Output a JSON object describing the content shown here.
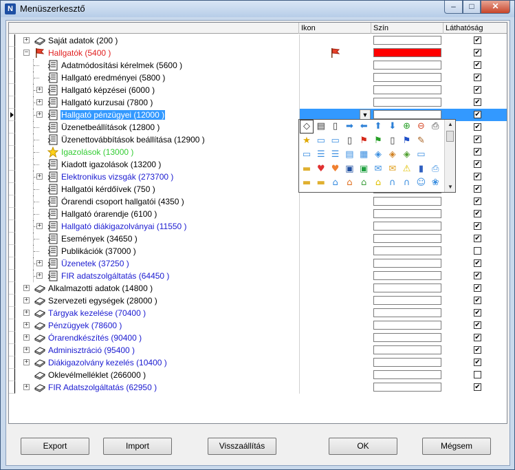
{
  "window": {
    "title": "Menüszerkesztő",
    "app_icon": "N",
    "minimize": "–",
    "maximize": "□",
    "close": "✕"
  },
  "columns": {
    "c1": "",
    "ikon": "Ikon",
    "szin": "Szín",
    "lathatosag": "Láthatóság"
  },
  "rows": [
    {
      "label": "Saját adatok (200 )",
      "level": 0,
      "expand": "+",
      "icon": "book-icon",
      "color": "#000000",
      "swatch": "",
      "checked": true
    },
    {
      "label": "Hallgatók (5400 )",
      "level": 0,
      "expand": "−",
      "icon": "flag-icon",
      "color": "#e02020",
      "swatch": "#ff0000",
      "ikon": "flag",
      "checked": true
    },
    {
      "label": "Adatmódosítási kérelmek (5600 )",
      "level": 1,
      "expand": "",
      "icon": "doc-icon",
      "color": "#000000",
      "swatch": "",
      "checked": true
    },
    {
      "label": "Hallgató eredményei (5800 )",
      "level": 1,
      "expand": "",
      "icon": "doc-icon",
      "color": "#000000",
      "swatch": "",
      "checked": true
    },
    {
      "label": "Hallgató képzései (6000 )",
      "level": 1,
      "expand": "+",
      "icon": "doc-icon",
      "color": "#000000",
      "swatch": "",
      "checked": true
    },
    {
      "label": "Hallgató kurzusai (7800 )",
      "level": 1,
      "expand": "+",
      "icon": "doc-icon",
      "color": "#000000",
      "swatch": "",
      "checked": true
    },
    {
      "label": "Hallgató pénzügyei (12000 )",
      "level": 1,
      "expand": "+",
      "icon": "doc-icon",
      "color": "#1a1ad0",
      "swatch": "",
      "checked": true,
      "selected": true
    },
    {
      "label": "Üzenetbeállítások (12800 )",
      "level": 1,
      "expand": "",
      "icon": "doc-icon",
      "color": "#000000",
      "swatch": "",
      "checked": true
    },
    {
      "label": "Üzenettovábbítások beállítása (12900 )",
      "level": 1,
      "expand": "",
      "icon": "doc-icon",
      "color": "#000000",
      "swatch": "",
      "checked": true
    },
    {
      "label": "Igazolások (13000 )",
      "level": 1,
      "expand": "",
      "icon": "star-icon",
      "color": "#33cc33",
      "swatch": "",
      "checked": true
    },
    {
      "label": "Kiadott igazolások (13200 )",
      "level": 1,
      "expand": "",
      "icon": "doc-icon",
      "color": "#000000",
      "swatch": "",
      "checked": true
    },
    {
      "label": "Elektronikus vizsgák (273700 )",
      "level": 1,
      "expand": "+",
      "icon": "doc-icon",
      "color": "#1a1ad0",
      "swatch": "",
      "checked": true
    },
    {
      "label": "Hallgatói kérdőívek (750 )",
      "level": 1,
      "expand": "",
      "icon": "doc-icon",
      "color": "#000000",
      "swatch": "",
      "checked": true
    },
    {
      "label": "Órarendi csoport hallgatói (4350 )",
      "level": 1,
      "expand": "",
      "icon": "doc-icon",
      "color": "#000000",
      "swatch": "",
      "checked": true
    },
    {
      "label": "Hallgató órarendje (6100 )",
      "level": 1,
      "expand": "",
      "icon": "doc-icon",
      "color": "#000000",
      "swatch": "",
      "checked": true
    },
    {
      "label": "Hallgató diákigazolványai (11550 )",
      "level": 1,
      "expand": "+",
      "icon": "doc-icon",
      "color": "#1a1ad0",
      "swatch": "",
      "checked": true
    },
    {
      "label": "Események (34650 )",
      "level": 1,
      "expand": "",
      "icon": "doc-icon",
      "color": "#000000",
      "swatch": "",
      "checked": true
    },
    {
      "label": "Publikációk (37000 )",
      "level": 1,
      "expand": "",
      "icon": "doc-icon",
      "color": "#000000",
      "swatch": "",
      "checked": false
    },
    {
      "label": "Üzenetek (37250 )",
      "level": 1,
      "expand": "+",
      "icon": "doc-icon",
      "color": "#1a1ad0",
      "swatch": "",
      "checked": true
    },
    {
      "label": "FIR adatszolgáltatás (64450 )",
      "level": 1,
      "expand": "+",
      "icon": "doc-icon",
      "color": "#1a1ad0",
      "swatch": "",
      "checked": true
    },
    {
      "label": "Alkalmazotti adatok (14800 )",
      "level": 0,
      "expand": "+",
      "icon": "book-icon",
      "color": "#000000",
      "swatch": "",
      "checked": true
    },
    {
      "label": "Szervezeti egységek (28000 )",
      "level": 0,
      "expand": "+",
      "icon": "book-icon",
      "color": "#000000",
      "swatch": "",
      "checked": true
    },
    {
      "label": "Tárgyak kezelése (70400 )",
      "level": 0,
      "expand": "+",
      "icon": "book-icon",
      "color": "#1a1ad0",
      "swatch": "",
      "checked": true
    },
    {
      "label": "Pénzügyek (78600 )",
      "level": 0,
      "expand": "+",
      "icon": "book-icon",
      "color": "#1a1ad0",
      "swatch": "",
      "checked": true
    },
    {
      "label": "Órarendkészítés (90400 )",
      "level": 0,
      "expand": "+",
      "icon": "book-icon",
      "color": "#1a1ad0",
      "swatch": "",
      "checked": true
    },
    {
      "label": "Adminisztráció (95400 )",
      "level": 0,
      "expand": "+",
      "icon": "book-icon",
      "color": "#1a1ad0",
      "swatch": "",
      "checked": true
    },
    {
      "label": "Diákigazolvány kezelés (10400 )",
      "level": 0,
      "expand": "+",
      "icon": "book-icon",
      "color": "#1a1ad0",
      "swatch": "",
      "checked": true
    },
    {
      "label": "Oklevélmelléklet (266000 )",
      "level": 0,
      "expand": "",
      "icon": "book-icon",
      "color": "#000000",
      "swatch": "",
      "checked": false
    },
    {
      "label": "FIR Adatszolgáltatás (62950 )",
      "level": 0,
      "expand": "+",
      "icon": "book-icon",
      "color": "#1a1ad0",
      "swatch": "",
      "checked": true
    }
  ],
  "picker_icons": [
    [
      "book",
      "doc",
      "page",
      "arrow-right",
      "arrow-left",
      "arrow-up",
      "arrow-down",
      "plus",
      "minus",
      "printer"
    ],
    [
      "star",
      "chat",
      "chat2",
      "page2",
      "flag-red",
      "flag-green",
      "page3",
      "flag-blue",
      "pencil"
    ],
    [
      "window",
      "list",
      "list2",
      "card",
      "calendar",
      "tag",
      "tag2",
      "tag3",
      "window2"
    ],
    [
      "folder",
      "heart",
      "heart2",
      "floppy",
      "floppy-green",
      "mail",
      "mail2",
      "warning",
      "chart",
      "printer2"
    ],
    [
      "folder2",
      "folder-add",
      "house",
      "house2",
      "house3",
      "house4",
      "magnet",
      "magnet2",
      "people",
      "cluster"
    ]
  ],
  "buttons": {
    "export": "Export",
    "import": "Import",
    "reset": "Visszaállítás",
    "ok": "OK",
    "cancel": "Mégsem"
  }
}
